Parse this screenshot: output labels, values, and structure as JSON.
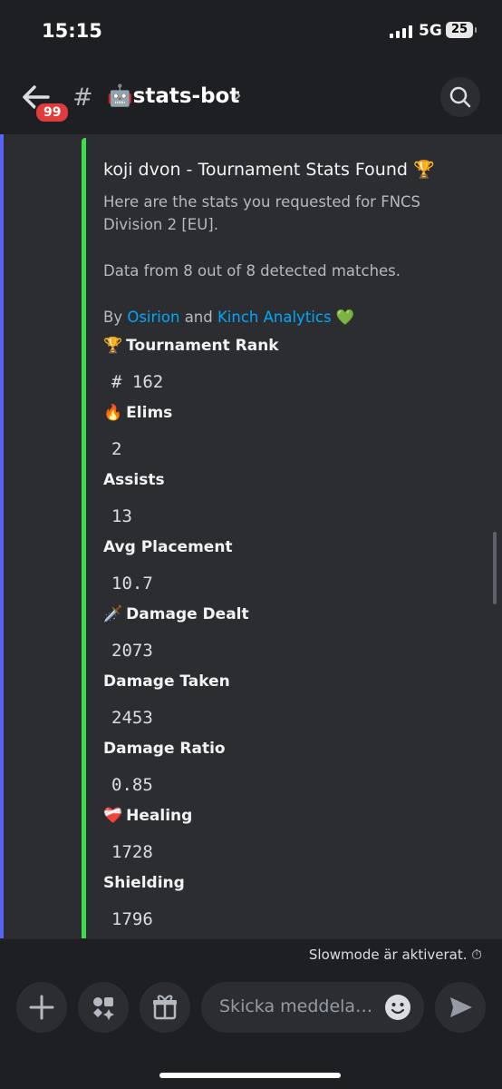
{
  "status": {
    "time": "15:15",
    "network": "5G",
    "battery": "25"
  },
  "header": {
    "unread_count": "99",
    "hash": "#",
    "channel_emoji": "🤖",
    "channel_name": "stats-bot",
    "chevron": "›"
  },
  "embed": {
    "accent_color": "#3ddc4b",
    "title": "koji dvon - Tournament Stats Found",
    "title_emoji": "🏆",
    "desc_line1": "Here are the stats you requested for FNCS Division 2 [EU].",
    "desc_line2": "Data from 8 out of 8 detected matches.",
    "by_prefix": "By",
    "link1": "Osirion",
    "and": "and",
    "link2": "Kinch Analytics",
    "heart_emoji": "💚",
    "fields": [
      {
        "emoji": "🏆",
        "name": "Tournament Rank",
        "value": "# 162"
      },
      {
        "emoji": "🔥",
        "name": "Elims",
        "value": "2"
      },
      {
        "emoji": "",
        "name": "Assists",
        "value": "13"
      },
      {
        "emoji": "",
        "name": "Avg Placement",
        "value": "10.7"
      },
      {
        "emoji": "🗡️",
        "name": "Damage Dealt",
        "value": "2073"
      },
      {
        "emoji": "",
        "name": "Damage Taken",
        "value": "2453"
      },
      {
        "emoji": "",
        "name": "Damage Ratio",
        "value": "0.85"
      },
      {
        "emoji": "❤️‍🩹",
        "name": "Healing",
        "value": "1728"
      },
      {
        "emoji": "",
        "name": "Shielding",
        "value": "1796"
      }
    ]
  },
  "slowmode": {
    "text": "Slowmode är aktiverat.",
    "icon": "⏱"
  },
  "composer": {
    "placeholder": "Skicka meddela…",
    "icons": [
      "plus-icon",
      "apps-icon",
      "gift-icon",
      "emoji-icon",
      "send-icon"
    ]
  }
}
